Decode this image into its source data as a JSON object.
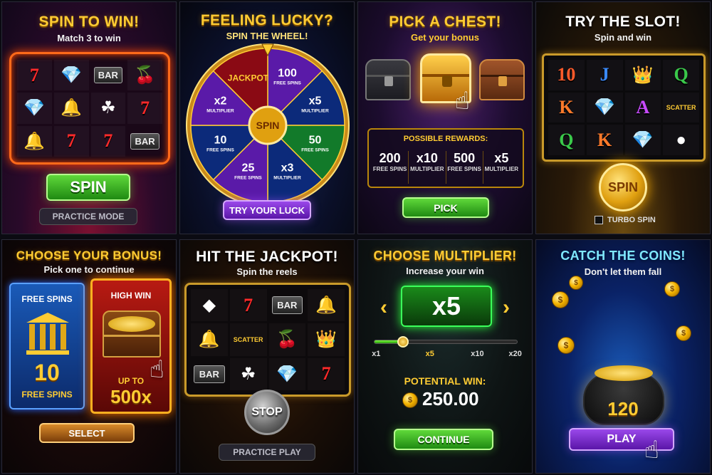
{
  "panels": {
    "spin_to_win": {
      "title": "SPIN TO WIN!",
      "subtitle": "Match 3 to win",
      "symbols": [
        "7",
        "💎",
        "BAR",
        "🍒",
        "💎",
        "🔔",
        "☘",
        "7",
        "🔔",
        "7",
        "7",
        "BAR"
      ],
      "spin_label": "SPIN",
      "practice_label": "PRACTICE MODE"
    },
    "feeling_lucky": {
      "title": "FEELING LUCKY?",
      "subtitle": "SPIN THE WHEEL!",
      "segments": [
        {
          "big": "100",
          "small": "FREE SPINS"
        },
        {
          "big": "x5",
          "small": "MULTIPLIER"
        },
        {
          "big": "50",
          "small": "FREE SPINS"
        },
        {
          "big": "x3",
          "small": "MULTIPLIER"
        },
        {
          "big": "25",
          "small": "FREE SPINS"
        },
        {
          "big": "10",
          "small": "FREE SPINS"
        },
        {
          "big": "x2",
          "small": "MULTIPLIER"
        },
        {
          "big": "JACKPOT",
          "small": ""
        }
      ],
      "center_label": "SPIN",
      "button_label": "TRY YOUR LUCK"
    },
    "pick_chest": {
      "title": "PICK A CHEST!",
      "subtitle": "Get your bonus",
      "rewards_header": "POSSIBLE REWARDS:",
      "rewards": [
        {
          "big": "200",
          "small": "FREE SPINS"
        },
        {
          "big": "x10",
          "small": "MULTIPLIER"
        },
        {
          "big": "500",
          "small": "FREE SPINS"
        },
        {
          "big": "x5",
          "small": "MULTIPLIER"
        }
      ],
      "pick_label": "PICK"
    },
    "try_slot": {
      "title": "TRY THE SLOT!",
      "subtitle": "Spin and win",
      "symbols": [
        "10",
        "J",
        "👑",
        "Q",
        "K",
        "💎",
        "A",
        "SCATTER",
        "Q",
        "K",
        "💎",
        "●"
      ],
      "spin_label": "SPIN",
      "turbo_label": "TURBO SPIN"
    },
    "choose_bonus": {
      "title": "CHOOSE YOUR BONUS!",
      "subtitle": "Pick one to continue",
      "left_card_title": "FREE SPINS",
      "left_card_big": "10",
      "left_card_small": "FREE SPINS",
      "right_card_title": "HIGH WIN",
      "right_card_small": "UP TO",
      "right_card_big": "500x",
      "select_label": "SELECT"
    },
    "hit_jackpot": {
      "title": "HIT THE JACKPOT!",
      "subtitle": "Spin the reels",
      "symbols": [
        "◆",
        "7",
        "BAR",
        "🔔",
        "🔔",
        "SCATTER",
        "🍒",
        "👑",
        "BAR",
        "☘",
        "💎",
        "7"
      ],
      "stop_label": "STOP",
      "practice_label": "PRACTICE PLAY"
    },
    "choose_multiplier": {
      "title": "CHOOSE MULTIPLIER!",
      "subtitle": "Increase your win",
      "current": "x5",
      "ticks": [
        "x1",
        "x5",
        "x10",
        "x20"
      ],
      "slider_value": 0.2,
      "potential_label": "POTENTIAL WIN:",
      "potential_value": "250.00",
      "continue_label": "CONTINUE"
    },
    "catch_coins": {
      "title": "CATCH THE COINS!",
      "subtitle": "Don't let them fall",
      "pot_value": "120",
      "play_label": "PLAY"
    }
  }
}
